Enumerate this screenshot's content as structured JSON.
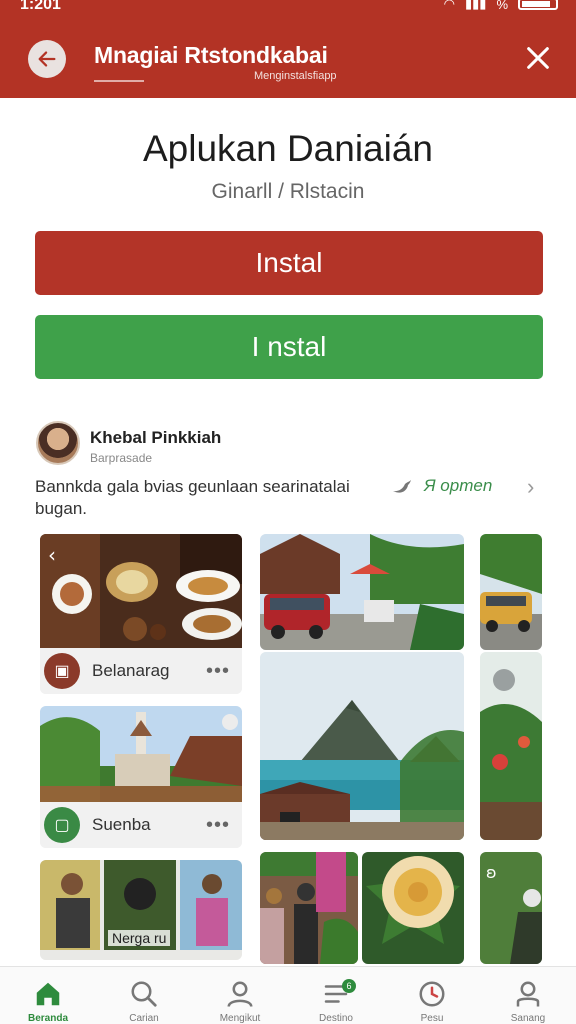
{
  "status_bar": {
    "time": "1:201",
    "signal": "%"
  },
  "header": {
    "title": "Mnagiai Rtstondkabai",
    "subtitle": "Menginstalsfiapp",
    "bar_color": "#b33325"
  },
  "app": {
    "title": "Aplukan Daniaián",
    "subtitle": "Ginarll / Rlstacin"
  },
  "buttons": {
    "install_primary": "Instal",
    "install_secondary": "I nstal",
    "primary_color": "#b33428",
    "secondary_color": "#3fa14a"
  },
  "post": {
    "author": "Khebal Pinkkiah",
    "meta": "Barprasade",
    "text": "Bannkda gala bvias geunlaan searinatalai bugan.",
    "share_label": "Я opmen"
  },
  "tiles": [
    {
      "label": "Belanarag",
      "icon": "bag-icon",
      "icon_color": "#8b3a2a"
    },
    {
      "label": "Suenba",
      "icon": "phone-icon",
      "icon_color": "#3a8a45"
    },
    {
      "label": "Nerga ru"
    }
  ],
  "bottom_nav": [
    {
      "label": "Beranda",
      "icon": "home-icon",
      "active": true
    },
    {
      "label": "Carian",
      "icon": "search-icon"
    },
    {
      "label": "Mengikut",
      "icon": "person-icon"
    },
    {
      "label": "Destino",
      "icon": "list-icon",
      "badge": "6"
    },
    {
      "label": "Pesu",
      "icon": "clock-icon"
    },
    {
      "label": "Sanang",
      "icon": "profile-icon"
    }
  ]
}
